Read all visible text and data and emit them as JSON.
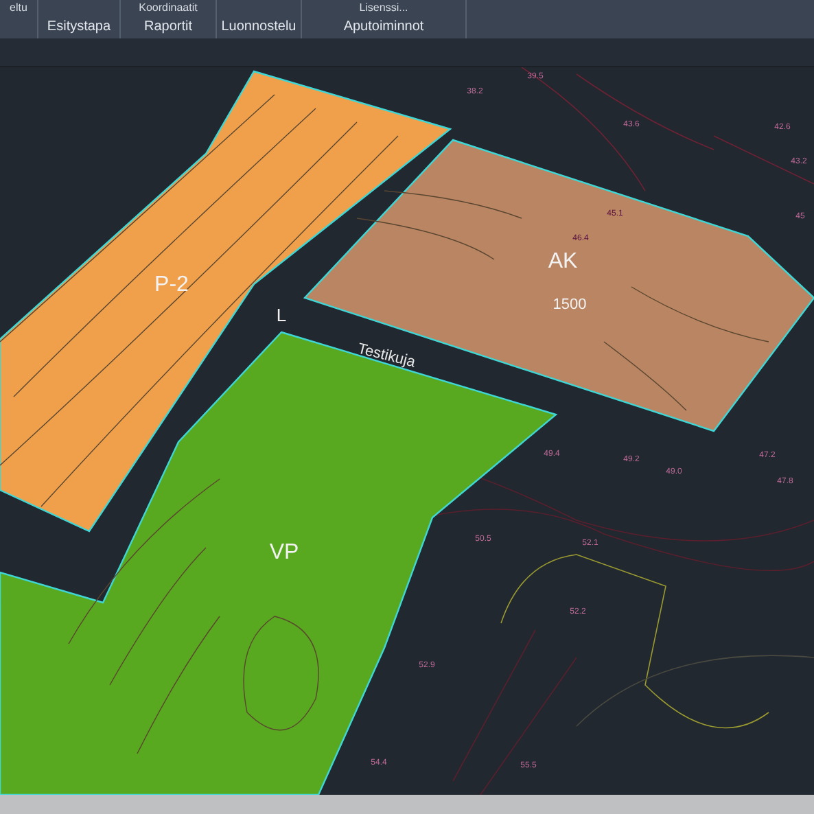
{
  "ribbon": {
    "groups": [
      {
        "top": "eltu"
      },
      {
        "label": "Esitystapa"
      },
      {
        "label": "Raportit",
        "top": "Koordinaatit"
      },
      {
        "label": "Luonnostelu"
      },
      {
        "label": "Aputoiminnot",
        "top": "Lisenssi..."
      }
    ]
  },
  "map": {
    "zones": [
      {
        "kind": "orange",
        "label": "P-2",
        "color": "#f0a04b"
      },
      {
        "kind": "brown",
        "label": "AK",
        "area": "1500",
        "color": "#b98562"
      },
      {
        "kind": "green",
        "label": "VP",
        "color": "#58a91f"
      }
    ],
    "street": "Testikuja",
    "block_mark": "L",
    "elevations": [
      "39.5",
      "38.2",
      "43.6",
      "42.6",
      "43.2",
      "46.4",
      "45.1",
      "45",
      "49.4",
      "49.2",
      "49.0",
      "47.2",
      "47.8",
      "50.5",
      "52.1",
      "52.2",
      "52.9",
      "54.4",
      "55.5"
    ]
  }
}
